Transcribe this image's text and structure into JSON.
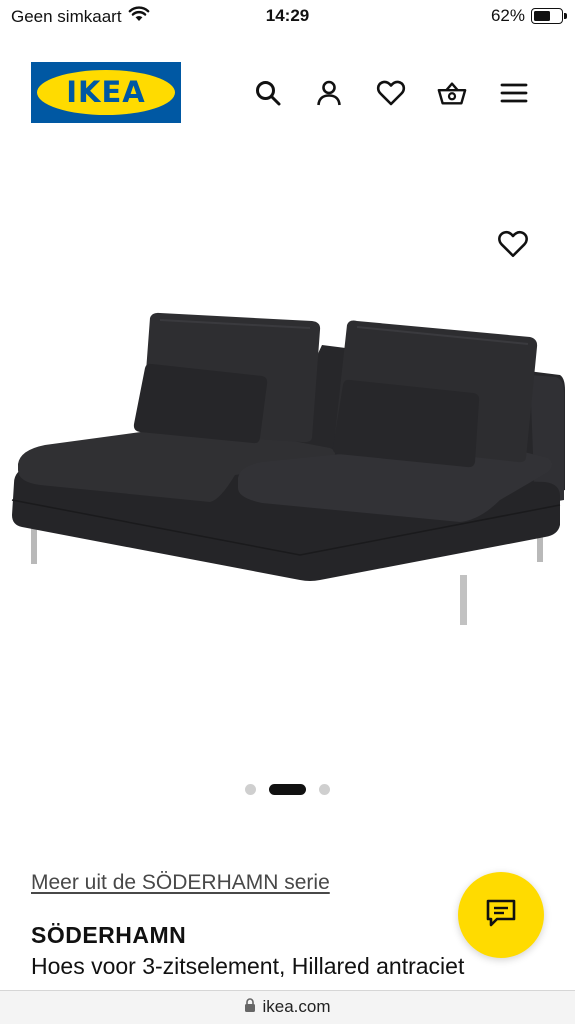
{
  "status_bar": {
    "carrier": "Geen simkaart",
    "time": "14:29",
    "battery_percent_label": "62%",
    "battery_level": 0.62
  },
  "header": {
    "logo_text": "IKEA",
    "icons": [
      "search-icon",
      "account-icon",
      "wishlist-heart-icon",
      "shopping-basket-icon",
      "menu-icon"
    ]
  },
  "product": {
    "image_alt": "SÖDERHAMN sofa section",
    "series_link": "Meer uit de SÖDERHAMN serie",
    "name": "SÖDERHAMN",
    "description": "Hoes voor 3-zitselement, Hillared antraciet"
  },
  "carousel": {
    "total": 3,
    "active_index": 1
  },
  "url_bar": {
    "domain": "ikea.com"
  },
  "colors": {
    "ikea_blue": "#0058a3",
    "ikea_yellow": "#ffdb00",
    "sofa_fabric": "#2a2a2d"
  }
}
